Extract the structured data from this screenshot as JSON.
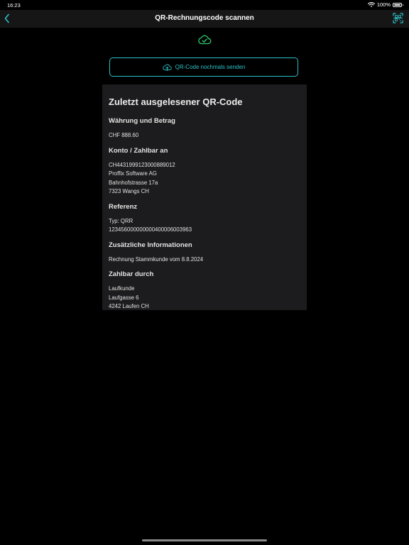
{
  "status_bar": {
    "time": "16:23",
    "battery_text": "100%",
    "battery_level": 1.0
  },
  "nav": {
    "title": "QR-Rechnungscode scannen",
    "back_icon": "chevron-left-icon",
    "scan_icon": "qr-scan-icon"
  },
  "status_icon": "cloud-check-icon",
  "resend_button": {
    "label": "QR-Code nochmals senden",
    "icon": "cloud-upload-icon"
  },
  "card": {
    "title": "Zuletzt ausgelesener QR-Code",
    "sections": [
      {
        "heading": "Währung und Betrag",
        "lines": [
          "CHF 888.60"
        ]
      },
      {
        "heading": "Konto / Zahlbar an",
        "lines": [
          "CH4431999123000889012",
          "Proffix Software AG",
          "Bahnhofstrasse 17a",
          "7323 Wangs CH"
        ]
      },
      {
        "heading": "Referenz",
        "lines": [
          "Typ: QRR",
          "123456000000000400006003963"
        ]
      },
      {
        "heading": "Zusätzliche Informationen",
        "lines": [
          "Rechnung Stammkunde vom 8.8.2024"
        ]
      },
      {
        "heading": "Zahlbar durch",
        "lines": [
          "Laufkunde",
          "Laufgasse 6",
          "4242 Laufen CH"
        ]
      }
    ]
  },
  "colors": {
    "accent": "#2cc0c8",
    "success": "#2ecc71",
    "background": "#000000",
    "card": "#1c1c1e",
    "nav": "#161616"
  }
}
